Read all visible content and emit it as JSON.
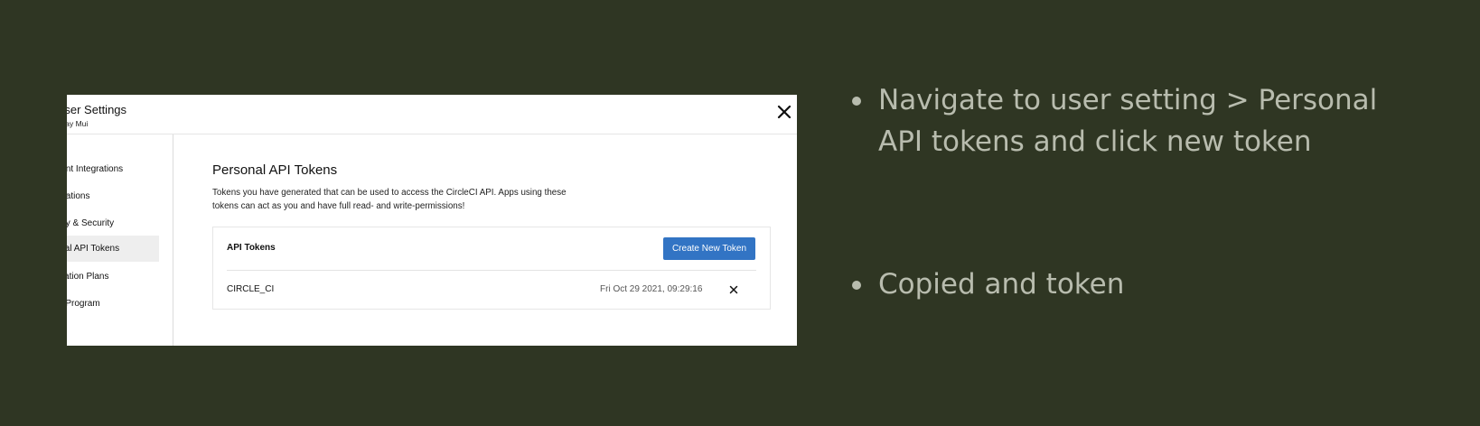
{
  "settings": {
    "title": "User Settings",
    "user_name": "Jay Mui",
    "sidebar": [
      {
        "label": "Account Integrations",
        "active": false
      },
      {
        "label": "Notifications",
        "active": false
      },
      {
        "label": "Privacy & Security",
        "active": false
      },
      {
        "label": "Personal API Tokens",
        "active": true
      },
      {
        "label": "Organization Plans",
        "active": false
      },
      {
        "label": "Beta Program",
        "active": false
      }
    ],
    "main": {
      "title": "Personal API Tokens",
      "description": "Tokens you have generated that can be used to access the CircleCI API. Apps using these tokens can act as you and have full read- and write-permissions!",
      "tokens_label": "API Tokens",
      "create_button": "Create New Token",
      "tokens": [
        {
          "name": "CIRCLE_CI",
          "created": "Fri Oct 29 2021, 09:29:16"
        }
      ]
    },
    "colors": {
      "accent": "#3274c4",
      "background": "#2f3623",
      "bullet_text": "#b8bcae"
    }
  },
  "bullets": [
    "Navigate to user setting > Personal API tokens and click new token",
    "Copied and token"
  ]
}
